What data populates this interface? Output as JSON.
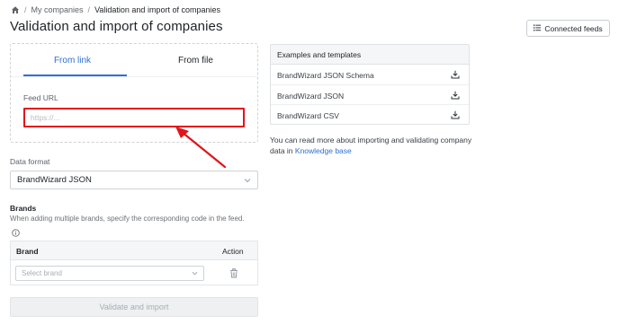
{
  "breadcrumb": {
    "items": [
      "My companies",
      "Validation and import of companies"
    ],
    "separator": "/"
  },
  "page": {
    "title": "Validation and import of companies"
  },
  "header": {
    "connected_feeds_label": "Connected feeds"
  },
  "source_tabs": [
    {
      "label": "From link",
      "active": true
    },
    {
      "label": "From file",
      "active": false
    }
  ],
  "feed_url": {
    "label": "Feed URL",
    "placeholder": "https://...",
    "value": ""
  },
  "data_format": {
    "label": "Data format",
    "selected": "BrandWizard JSON"
  },
  "brands": {
    "title": "Brands",
    "hint": "When adding multiple brands, specify the corresponding code in the feed.",
    "columns": [
      "Brand",
      "Action"
    ],
    "select_placeholder": "Select brand"
  },
  "validate_label": "Validate and import",
  "examples": {
    "title": "Examples and templates",
    "items": [
      "BrandWizard JSON Schema",
      "BrandWizard JSON",
      "BrandWizard CSV"
    ]
  },
  "info": {
    "text": "You can read more about importing and validating company data in",
    "link": "Knowledge base"
  },
  "colors": {
    "accent": "#2f6fd6",
    "highlight": "#e3131b"
  }
}
